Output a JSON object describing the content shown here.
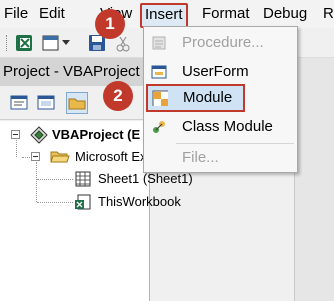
{
  "menubar": {
    "items": [
      {
        "label": "File",
        "key": "F"
      },
      {
        "label": "Edit",
        "key": "E"
      },
      {
        "label": "View",
        "key": "V"
      },
      {
        "label": "Insert",
        "key": "I"
      },
      {
        "label": "Format",
        "key": "o"
      },
      {
        "label": "Debug",
        "key": "D"
      },
      {
        "label": "R",
        "key": "R"
      }
    ]
  },
  "project": {
    "title": "Project - VBAProject",
    "tree": {
      "root": "VBAProject (E",
      "folder": "Microsoft Ex",
      "sheet": "Sheet1 (Sheet1)",
      "workbook": "ThisWorkbook"
    }
  },
  "insert_menu": {
    "items": [
      {
        "label": "Procedure...",
        "icon": "procedure-icon",
        "enabled": false
      },
      {
        "label": "UserForm",
        "icon": "userform-icon",
        "enabled": true
      },
      {
        "label": "Module",
        "icon": "module-icon",
        "enabled": true,
        "highlighted": true
      },
      {
        "label": "Class Module",
        "icon": "class-module-icon",
        "enabled": true
      },
      {
        "label": "File...",
        "icon": "",
        "enabled": false
      }
    ]
  },
  "callouts": {
    "step1": "1",
    "step2": "2"
  },
  "colors": {
    "callout": "#c0392b",
    "highlight_bg": "#cfe3f5",
    "disabled_text": "#a0a0a0"
  }
}
